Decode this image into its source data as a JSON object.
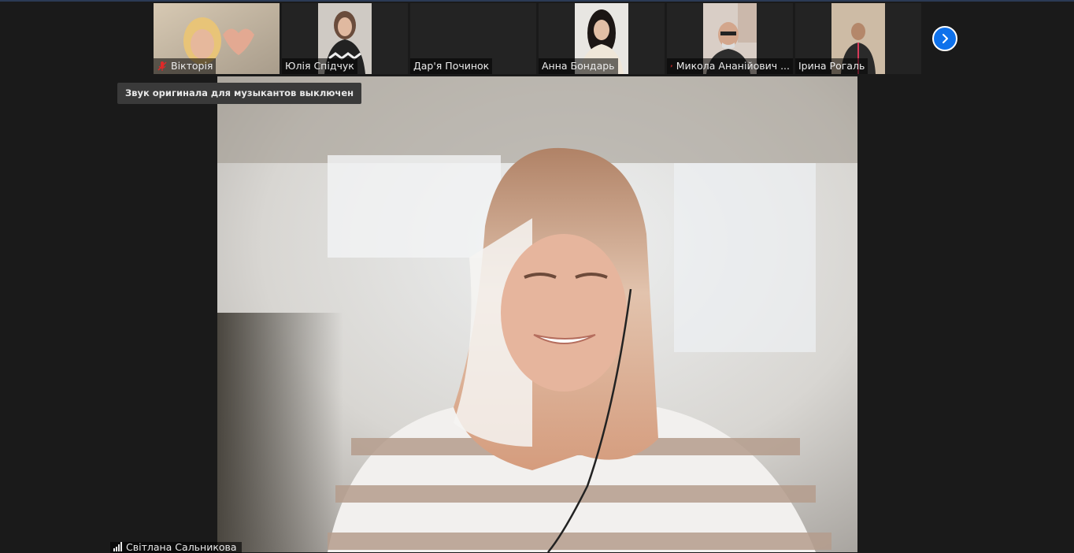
{
  "participants": [
    {
      "name": "Вікторія",
      "muted": true
    },
    {
      "name": "Юлія Спідчук",
      "muted": false
    },
    {
      "name": "Дар'я Починок",
      "muted": false
    },
    {
      "name": "Анна Бондарь",
      "muted": false
    },
    {
      "name": "Микола Ананійович ...",
      "muted": true
    },
    {
      "name": "Ірина Рогаль",
      "muted": false
    }
  ],
  "tooltip": "Звук оригинала для музыкантов выключен",
  "active_speaker": {
    "name": "Світлана Сальникова"
  },
  "icons": {
    "next_page": "chevron-right-icon",
    "muted_mic": "mic-muted-icon",
    "signal": "signal-strength-icon"
  },
  "colors": {
    "accent": "#0e71eb",
    "muted_icon": "#e02828",
    "background": "#1a1a1a"
  }
}
